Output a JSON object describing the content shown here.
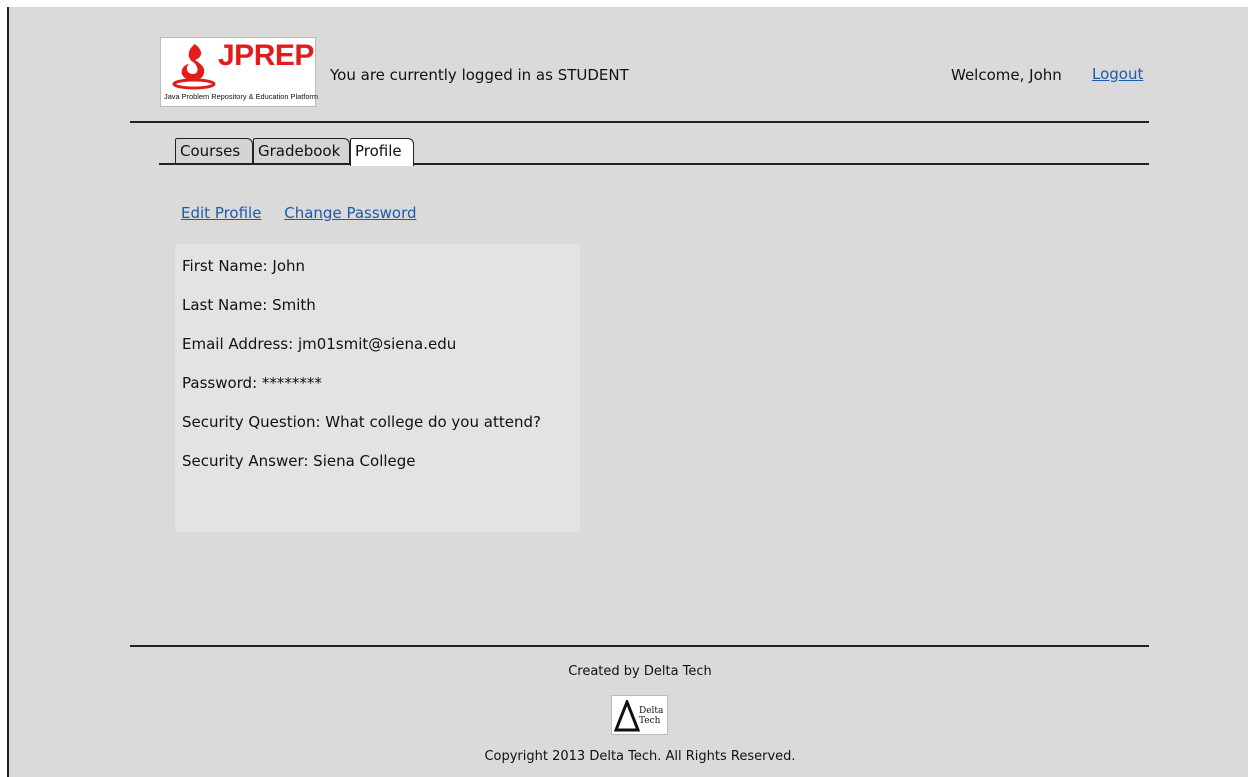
{
  "header": {
    "logo_text": "JPREP",
    "logo_tagline": "Java Problem Repository & Education Platform",
    "login_status": "You are currently logged in as STUDENT",
    "welcome": "Welcome, John",
    "logout_label": "Logout"
  },
  "tabs": [
    {
      "label": "Courses",
      "active": false
    },
    {
      "label": "Gradebook",
      "active": false
    },
    {
      "label": "Profile",
      "active": true
    }
  ],
  "profile": {
    "edit_profile_label": "Edit Profile",
    "change_password_label": "Change Password",
    "fields": [
      "First Name: John",
      "Last Name: Smith",
      "Email Address: jm01smit@siena.edu",
      "Password: ********",
      "Security Question: What college do you attend?",
      "Security Answer: Siena College"
    ]
  },
  "footer": {
    "created_by": "Created by Delta Tech",
    "logo_line1": "Delta",
    "logo_line2": "Tech",
    "copyright": "Copyright 2013 Delta Tech. All Rights Reserved."
  },
  "colors": {
    "link": "#1d5aa8",
    "logo_red": "#e21c1c",
    "background": "#dadada"
  }
}
